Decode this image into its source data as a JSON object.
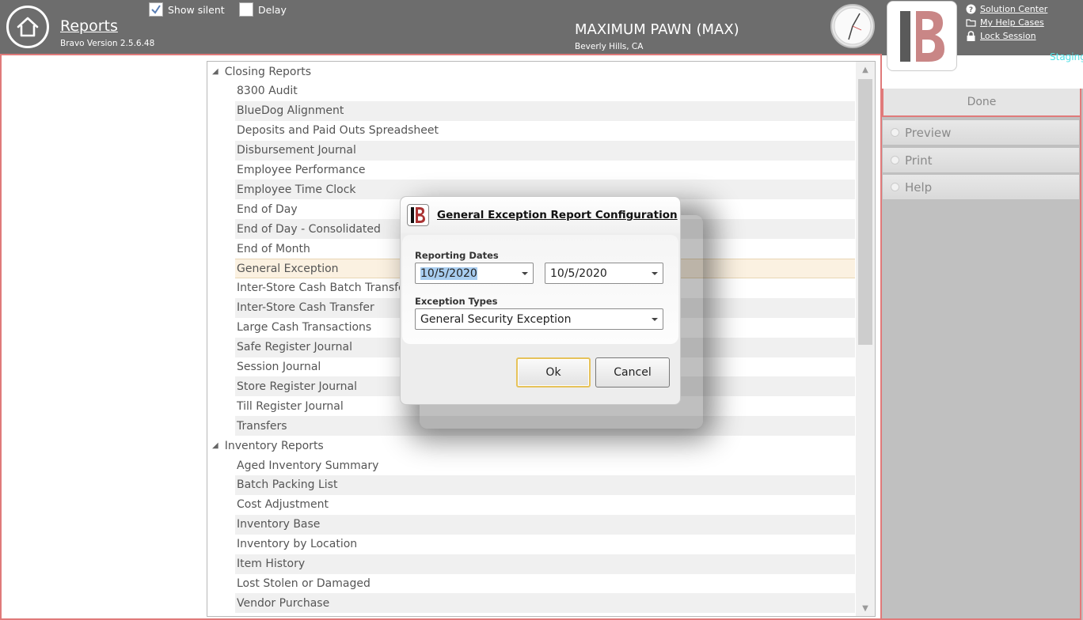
{
  "header": {
    "title": "Reports",
    "version": "Bravo Version 2.5.6.48",
    "show_silent_label": "Show silent",
    "show_silent_checked": true,
    "delay_label": "Delay",
    "delay_checked": false,
    "store_name": "MAXIMUM PAWN (MAX)",
    "store_location": "Beverly Hills, CA",
    "logo_label": "BRAVO",
    "links": [
      "Solution Center",
      "My Help Cases",
      "Lock Session"
    ],
    "environment": "Staging"
  },
  "side_panel": {
    "done": "Done",
    "buttons": [
      "Preview",
      "Print",
      "Help"
    ]
  },
  "tree": {
    "groups": [
      {
        "label": "Closing Reports",
        "items": [
          "8300 Audit",
          "BlueDog Alignment",
          "Deposits and Paid Outs Spreadsheet",
          "Disbursement Journal",
          "Employee Performance",
          "Employee Time Clock",
          "End of Day",
          "End of Day - Consolidated",
          "End of Month",
          "General Exception",
          "Inter-Store Cash Batch Transfer",
          "Inter-Store Cash Transfer",
          "Large Cash Transactions",
          "Safe Register Journal",
          "Session Journal",
          "Store Register Journal",
          "Till Register Journal",
          "Transfers"
        ]
      },
      {
        "label": "Inventory Reports",
        "items": [
          "Aged Inventory Summary",
          "Batch Packing List",
          "Cost Adjustment",
          "Inventory Base",
          "Inventory by Location",
          "Item History",
          "Lost Stolen or Damaged",
          "Vendor Purchase"
        ]
      }
    ],
    "selected": "General Exception"
  },
  "dialog": {
    "title": "General Exception Report Configuration",
    "reporting_dates_label": "Reporting Dates",
    "start_date": "10/5/2020",
    "end_date": "10/5/2020",
    "exception_types_label": "Exception Types",
    "exception_type": "General Security Exception",
    "ok": "Ok",
    "cancel": "Cancel"
  },
  "colors": {
    "header_bg": "#6d6d6d",
    "accent_red": "#e07a7a",
    "selected_row": "#fbf1e1",
    "staging": "#4fe0e6"
  }
}
